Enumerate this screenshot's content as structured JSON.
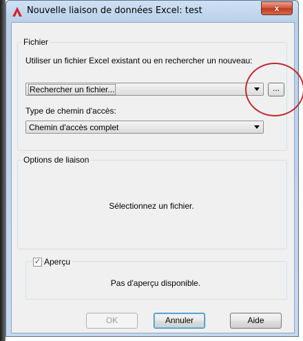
{
  "window": {
    "title": "Nouvelle liaison de données Excel: test",
    "close_label": "x"
  },
  "fichier_group": {
    "label": "Fichier",
    "instruction": "Utiliser un fichier Excel existant ou en rechercher un nouveau:",
    "file_select_value": "Rechercher un fichier...",
    "browse_label": "...",
    "path_type_label": "Type de chemin d'accès:",
    "path_type_value": "Chemin d'accès complet"
  },
  "options_group": {
    "label": "Options de liaison",
    "message": "Sélectionnez un fichier."
  },
  "preview_group": {
    "checkbox_label": "Aperçu",
    "checkbox_checked": true,
    "check_mark": "✓",
    "message": "Pas d'aperçu disponible."
  },
  "buttons": {
    "ok": "OK",
    "cancel": "Annuler",
    "help": "Aide"
  },
  "colors": {
    "accent_red": "#c0282e",
    "title_bar": "#b9d1ea",
    "client_bg": "#f0f0f0"
  }
}
